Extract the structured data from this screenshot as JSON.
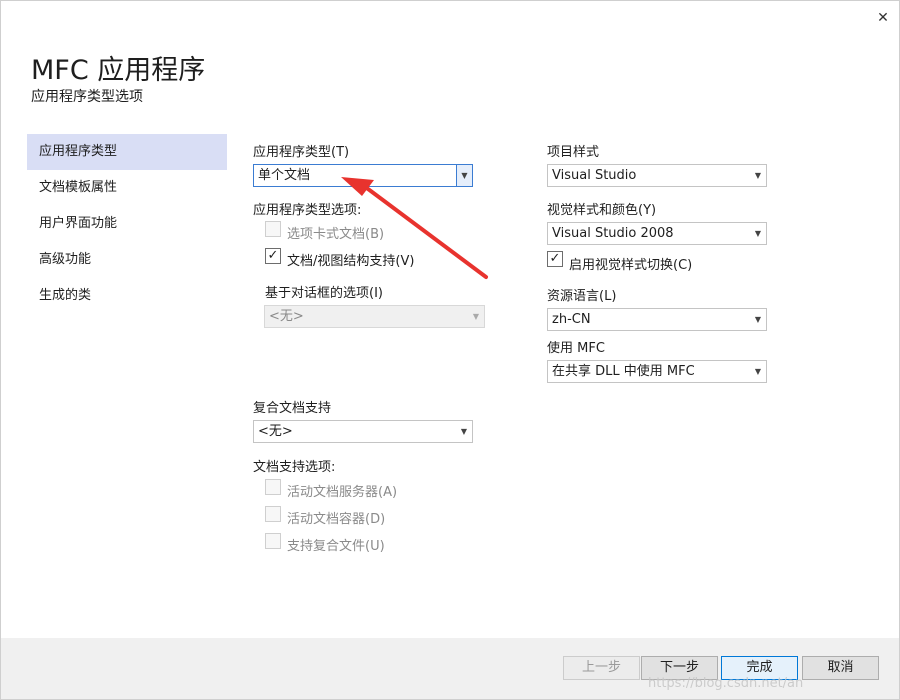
{
  "window": {
    "title": "MFC 应用程序",
    "subtitle": "应用程序类型选项",
    "close_glyph": "✕"
  },
  "sidebar": {
    "items": [
      {
        "label": "应用程序类型"
      },
      {
        "label": "文档模板属性"
      },
      {
        "label": "用户界面功能"
      },
      {
        "label": "高级功能"
      },
      {
        "label": "生成的类"
      }
    ]
  },
  "left": {
    "app_type_label": "应用程序类型(T)",
    "app_type_value": "单个文档",
    "app_type_options_label": "应用程序类型选项:",
    "tabbed_docs_label": "选项卡式文档(B)",
    "doc_view_label": "文档/视图结构支持(V)",
    "dialog_options_label": "基于对话框的选项(I)",
    "dialog_options_value": "<无>",
    "compound_label": "复合文档支持",
    "compound_value": "<无>",
    "doc_support_label": "文档支持选项:",
    "active_server_label": "活动文档服务器(A)",
    "active_container_label": "活动文档容器(D)",
    "compound_files_label": "支持复合文件(U)"
  },
  "right": {
    "project_style_label": "项目样式",
    "project_style_value": "Visual Studio",
    "visual_style_label": "视觉样式和颜色(Y)",
    "visual_style_value": "Visual Studio 2008",
    "enable_switch_label": "启用视觉样式切换(C)",
    "resource_lang_label": "资源语言(L)",
    "resource_lang_value": "zh-CN",
    "use_mfc_label": "使用 MFC",
    "use_mfc_value": "在共享 DLL 中使用 MFC"
  },
  "footer": {
    "prev_label": "上一步",
    "next_label": "下一步",
    "finish_label": "完成",
    "cancel_label": "取消"
  },
  "watermark": "https://blog.csdn.net/an",
  "colors": {
    "nav_active": "#d9def5",
    "annotation_arrow": "#e8332e",
    "footer_bg": "#f0f0f0"
  },
  "icons": {
    "check": "✓",
    "dropdown": "▼"
  }
}
